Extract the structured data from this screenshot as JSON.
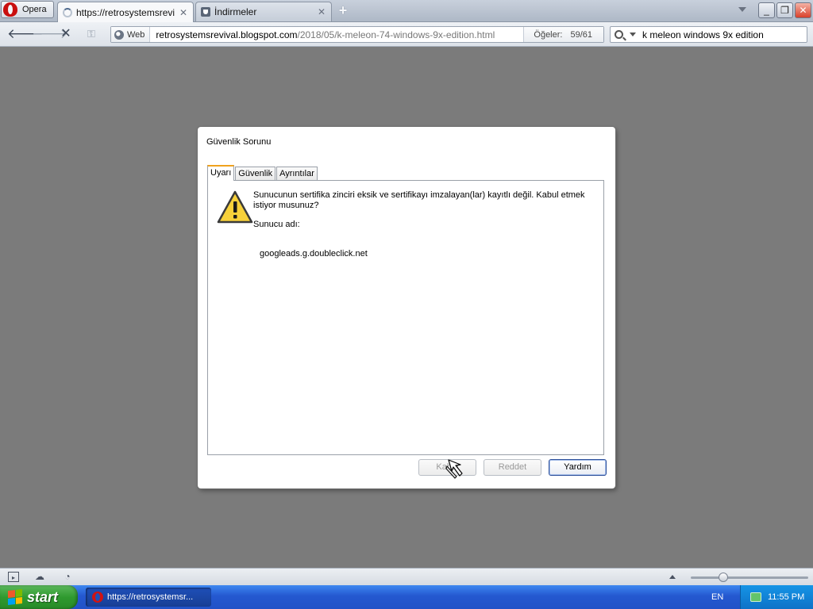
{
  "browser": {
    "menu_label": "Opera",
    "tabs": [
      {
        "title": "https://retrosystemsrevi..."
      },
      {
        "title": "İndirmeler"
      }
    ],
    "address": {
      "badge": "Web",
      "url_host": "retrosystemsrevival.blogspot.com",
      "url_path": "/2018/05/k-meleon-74-windows-9x-edition.html",
      "items_label": "Öğeler:",
      "items_count": "59/61"
    },
    "search": {
      "query": "k meleon windows 9x edition"
    },
    "icons": {
      "back": "back-arrow-icon",
      "forward": "forward-arrow-icon",
      "stop": "stop-icon",
      "wand": "wand-key-icon",
      "search": "magnifier-icon"
    }
  },
  "dialog": {
    "title": "Güvenlik Sorunu",
    "tabs": [
      "Uyarı",
      "Güvenlik",
      "Ayrıntılar"
    ],
    "message": "Sunucunun sertifika zinciri eksik ve sertifikayı imzalayan(lar) kayıtlı değil. Kabul etmek istiyor musunuz?",
    "server_label": "Sunucu adı:",
    "server_name": "googleads.g.doubleclick.net",
    "buttons": {
      "accept": "Kabul",
      "reject": "Reddet",
      "help": "Yardım"
    }
  },
  "taskbar": {
    "start_label": "start",
    "task_title": "https://retrosystemsr...",
    "language": "EN",
    "clock": "11:55 PM"
  },
  "colors": {
    "page_background": "#7b7b7b",
    "tab_accent": "#f0a21e",
    "warning_yellow": "#f7d13a",
    "taskbar_blue": "#2458d0",
    "start_green": "#2f9a2f"
  }
}
